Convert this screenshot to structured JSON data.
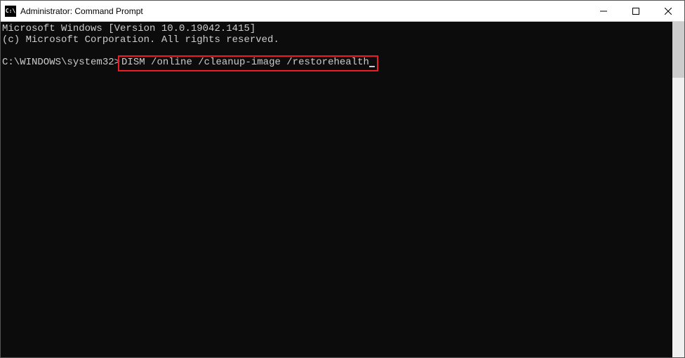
{
  "titlebar": {
    "icon_text": "C:\\",
    "title": "Administrator: Command Prompt"
  },
  "terminal": {
    "line1": "Microsoft Windows [Version 10.0.19042.1415]",
    "line2": "(c) Microsoft Corporation. All rights reserved.",
    "prompt": "C:\\WINDOWS\\system32>",
    "command": "DISM /online /cleanup-image /restorehealth"
  }
}
